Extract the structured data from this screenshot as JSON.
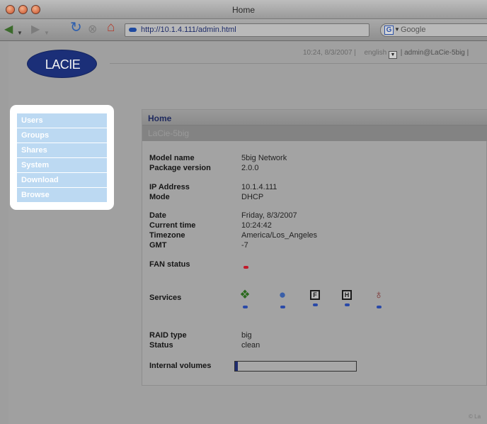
{
  "window": {
    "title": "Home"
  },
  "toolbar": {
    "back_icon": "back-arrow-icon",
    "forward_icon": "forward-arrow-icon",
    "reload_icon": "reload-icon",
    "stop_icon": "stop-icon",
    "home_icon": "home-icon",
    "url": "http://10.1.4.111/admin.html",
    "search_placeholder": "Google"
  },
  "header": {
    "logo": "LACIE",
    "datetime": "10:24, 8/3/2007 |",
    "language": "english",
    "user": "| admin@LaCie-5big |"
  },
  "nav": {
    "items": [
      {
        "label": "Users"
      },
      {
        "label": "Groups"
      },
      {
        "label": "Shares"
      },
      {
        "label": "System"
      },
      {
        "label": "Download"
      },
      {
        "label": "Browse"
      }
    ]
  },
  "panel": {
    "title": "Home",
    "subtitle": "LaCie-5big",
    "model_name": {
      "label": "Model name",
      "value": "5big Network"
    },
    "package_version": {
      "label": "Package version",
      "value": "2.0.0"
    },
    "ip_address": {
      "label": "IP Address",
      "value": "10.1.4.111"
    },
    "mode": {
      "label": "Mode",
      "value": "DHCP"
    },
    "date": {
      "label": "Date",
      "value": "Friday, 8/3/2007"
    },
    "current_time": {
      "label": "Current time",
      "value": "10:24:42"
    },
    "timezone": {
      "label": "Timezone",
      "value": "America/Los_Angeles"
    },
    "gmt": {
      "label": "GMT",
      "value": "-7"
    },
    "fan_status": {
      "label": "FAN status",
      "status_color": "#c21a2a"
    },
    "services": {
      "label": "Services",
      "items": [
        {
          "icon": "windows-icon"
        },
        {
          "icon": "apple-icon"
        },
        {
          "icon": "ftp-icon",
          "text": "F"
        },
        {
          "icon": "http-icon",
          "text": "H"
        },
        {
          "icon": "upnp-icon"
        }
      ],
      "status_color": "#2a4aa8"
    },
    "raid_type": {
      "label": "RAID type",
      "value": "big"
    },
    "status": {
      "label": "Status",
      "value": "clean"
    },
    "internal_volumes": {
      "label": "Internal volumes",
      "usage_fraction": 0.02
    }
  },
  "footer": {
    "text": "© La"
  }
}
